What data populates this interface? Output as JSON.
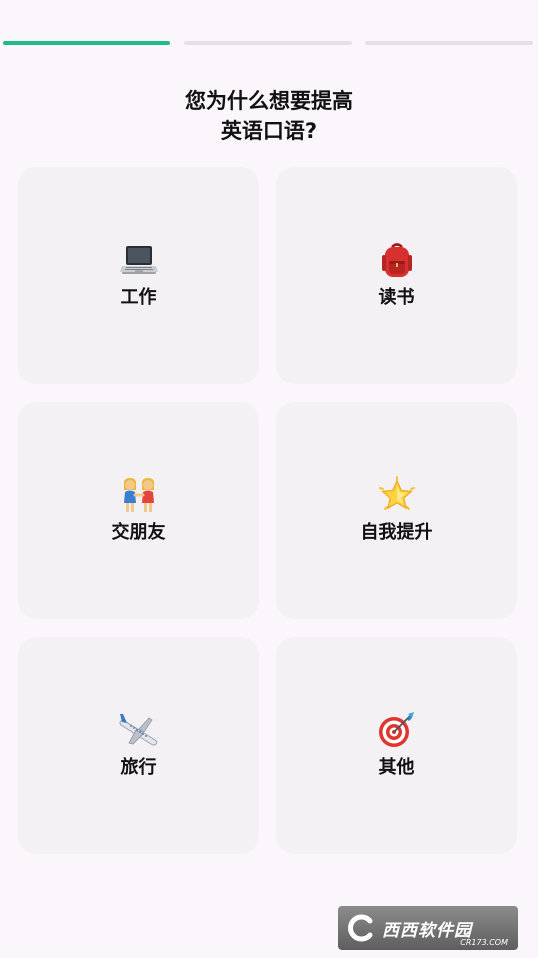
{
  "progress": {
    "total_steps": 3,
    "current_step": 1
  },
  "title": {
    "line1": "您为什么想要提高",
    "line2": "英语口语?"
  },
  "options": [
    {
      "label": "工作",
      "icon": "laptop-icon"
    },
    {
      "label": "读书",
      "icon": "backpack-icon"
    },
    {
      "label": "交朋友",
      "icon": "two-women-holding-hands-icon"
    },
    {
      "label": "自我提升",
      "icon": "glowing-star-icon"
    },
    {
      "label": "旅行",
      "icon": "airplane-icon"
    },
    {
      "label": "其他",
      "icon": "dart-target-icon"
    }
  ],
  "watermark": {
    "text": "西西软件园",
    "subtext": "CR173.COM"
  },
  "colors": {
    "background": "#fbf6fb",
    "card": "#f4f1f4",
    "progress_active": "#1dbb85",
    "progress_inactive": "#e4e0e5",
    "text": "#111111"
  }
}
